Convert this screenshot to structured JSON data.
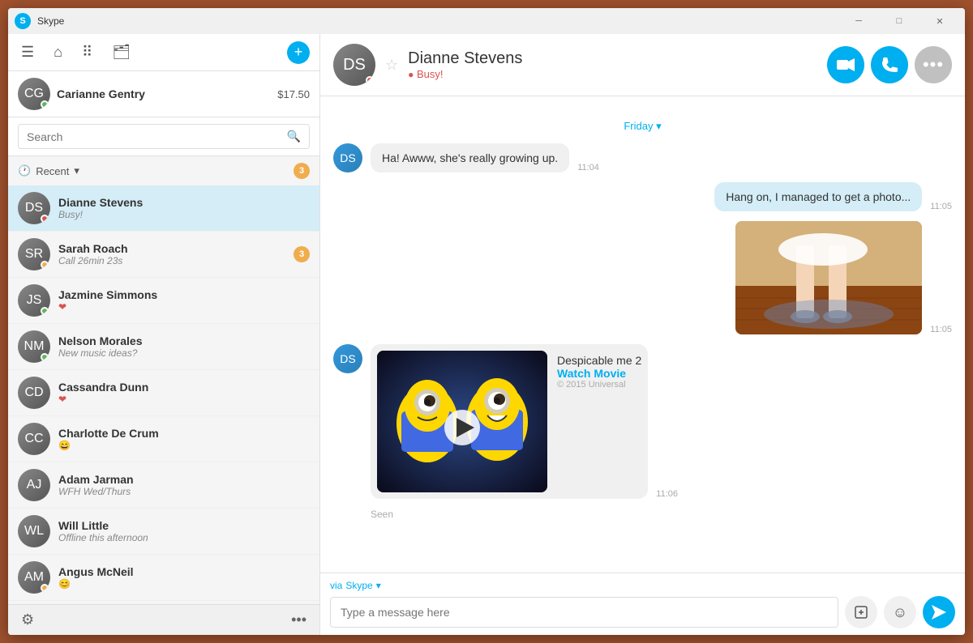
{
  "window": {
    "title": "Skype",
    "logo": "S"
  },
  "sidebar": {
    "user": {
      "name": "Carianne Gentry",
      "balance": "$17.50",
      "status": "online"
    },
    "search": {
      "placeholder": "Search"
    },
    "recent": {
      "label": "Recent",
      "badge": "3"
    },
    "contacts": [
      {
        "name": "Dianne Stevens",
        "status": "Busy!",
        "statusType": "busy",
        "active": true
      },
      {
        "name": "Sarah Roach",
        "status": "Call 26min 23s",
        "statusType": "away",
        "badge": "3"
      },
      {
        "name": "Jazmine Simmons",
        "status": "❤",
        "statusType": "online",
        "isEmoji": true
      },
      {
        "name": "Nelson Morales",
        "status": "New music ideas?",
        "statusType": "online"
      },
      {
        "name": "Cassandra Dunn",
        "status": "❤",
        "statusType": "none",
        "isEmoji": true
      },
      {
        "name": "Charlotte De Crum",
        "status": "😄",
        "statusType": "none",
        "isEmoji": true
      },
      {
        "name": "Adam Jarman",
        "status": "WFH Wed/Thurs",
        "statusType": "none"
      },
      {
        "name": "Will Little",
        "status": "Offline this afternoon",
        "statusType": "none"
      },
      {
        "name": "Angus McNeil",
        "status": "😊",
        "statusType": "away",
        "isEmoji": true
      }
    ]
  },
  "chat": {
    "contact": {
      "name": "Dianne Stevens",
      "status": "Busy!",
      "statusType": "busy"
    },
    "date_divider": "Friday ▾",
    "messages": [
      {
        "id": 1,
        "sender": "other",
        "text": "Ha! Awww, she's really growing up.",
        "time": "11:04",
        "type": "text"
      },
      {
        "id": 2,
        "sender": "self",
        "text": "Hang on, I managed to get a photo...",
        "time": "11:05",
        "type": "text"
      },
      {
        "id": 3,
        "sender": "self",
        "text": "",
        "time": "11:05",
        "type": "image"
      },
      {
        "id": 4,
        "sender": "other",
        "text": "",
        "time": "11:06",
        "type": "media",
        "media": {
          "title": "Despicable me 2",
          "link": "Watch Movie",
          "copyright": "© 2015 Universal"
        }
      }
    ],
    "seen_label": "Seen",
    "input": {
      "placeholder": "Type a message here",
      "via_label": "via Skype"
    }
  },
  "icons": {
    "menu": "☰",
    "home": "⌂",
    "grid": "⋮⋮",
    "contacts": "👤",
    "add": "+",
    "search": "🔍",
    "clock": "🕐",
    "settings": "⚙",
    "more": "•••",
    "video": "📷",
    "phone": "📞",
    "ellipsis": "•••",
    "send": "➤",
    "emoji": "☺",
    "file": "📁",
    "chevron": "▾"
  }
}
